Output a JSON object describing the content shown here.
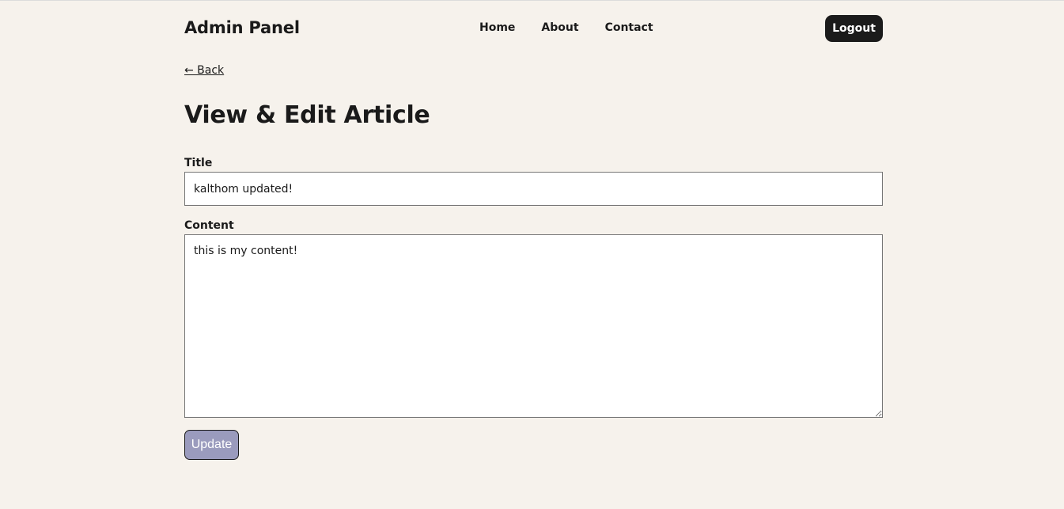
{
  "header": {
    "logo": "Admin Panel",
    "nav": [
      {
        "label": "Home"
      },
      {
        "label": "About"
      },
      {
        "label": "Contact"
      }
    ],
    "logout_label": "Logout"
  },
  "back_link": "← Back",
  "page_title": "View & Edit Article",
  "form": {
    "title_label": "Title",
    "title_value": "kalthom updated!",
    "content_label": "Content",
    "content_value": "this is my content!",
    "submit_label": "Update"
  },
  "colors": {
    "background": "#f6f2ec",
    "logout_button": "#1b1b1b",
    "update_button": "#9a9bbd"
  }
}
